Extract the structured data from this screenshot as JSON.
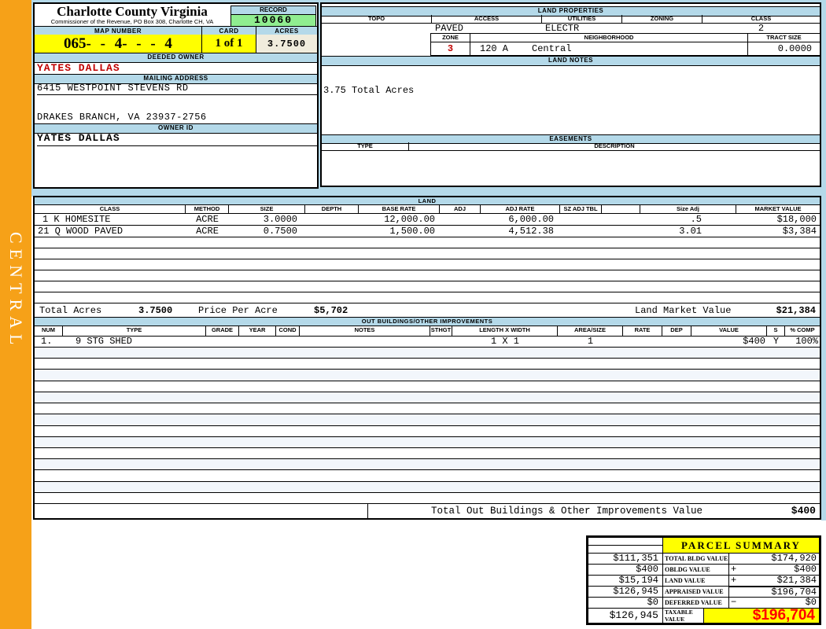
{
  "sidebar": {
    "district": "CENTRAL"
  },
  "header": {
    "county": "Charlotte County Virginia",
    "commissioner": "Commissioner of the Revenue, PO Box 308, Charlotte CH, VA",
    "record_label": "RECORD",
    "record_value": "10060",
    "map_number_label": "MAP NUMBER",
    "map_number": "065- - 4- - - 4",
    "card_label": "CARD",
    "card_value": "1 of 1",
    "acres_label": "ACRES",
    "acres_value": "3.7500"
  },
  "owner": {
    "deeded_owner_label": "DEEDED OWNER",
    "deeded_owner": "YATES DALLAS",
    "mailing_address_label": "MAILING ADDRESS",
    "address_line1": "6415 WESTPOINT STEVENS RD",
    "address_line2": "DRAKES BRANCH, VA 23937-2756",
    "owner_id_label": "OWNER ID",
    "owner_id": "YATES DALLAS"
  },
  "land_properties": {
    "title": "LAND PROPERTIES",
    "headers": [
      "TOPO",
      "ACCESS",
      "UTILITIES",
      "ZONING",
      "CLASS"
    ],
    "topo": "",
    "access": "PAVED",
    "utilities": "ELECTR",
    "zoning": "",
    "class_value": "2",
    "zone_label": "ZONE",
    "zone_value": "3",
    "neighborhood_label": "NEIGHBORHOOD",
    "neighborhood_code": "120 A",
    "neighborhood_name": "Central",
    "tract_size_label": "TRACT SIZE",
    "tract_size": "0.0000"
  },
  "land_notes": {
    "title": "LAND NOTES",
    "note": "3.75 Total Acres"
  },
  "easements": {
    "title": "EASEMENTS",
    "type_label": "TYPE",
    "description_label": "DESCRIPTION"
  },
  "land": {
    "title": "LAND",
    "headers": [
      "CLASS",
      "METHOD",
      "SIZE",
      "DEPTH",
      "BASE RATE",
      "ADJ",
      "ADJ RATE",
      "SZ ADJ TBL",
      "",
      "Size Adj",
      "MARKET VALUE"
    ],
    "rows": [
      [
        "1 K HOMESITE",
        "ACRE",
        "3.0000",
        "",
        "12,000.00",
        "",
        "6,000.00",
        "",
        "",
        ".5",
        "$18,000"
      ],
      [
        "21 Q WOOD PAVED",
        "ACRE",
        "0.7500",
        "",
        "1,500.00",
        "",
        "4,512.38",
        "",
        "",
        "3.01",
        "$3,384"
      ]
    ],
    "empty_rows": 6,
    "totals": {
      "total_acres_label": "Total Acres",
      "total_acres": "3.7500",
      "price_per_acre_label": "Price Per Acre",
      "price_per_acre": "$5,702",
      "land_market_value_label": "Land Market Value",
      "land_market_value": "$21,384"
    }
  },
  "out_buildings": {
    "title": "OUT BUILDINGS/OTHER IMPROVEMENTS",
    "headers": [
      "NUM",
      "TYPE",
      "GRADE",
      "YEAR",
      "COND",
      "NOTES",
      "STHGT",
      "LENGTH X WIDTH",
      "AREA/SIZE",
      "RATE",
      "DEP",
      "VALUE",
      "S",
      "% COMP"
    ],
    "rows": [
      [
        "1.",
        "9 STG SHED",
        "",
        "",
        "",
        "",
        "",
        "1 X 1",
        "1",
        "",
        "",
        "$400",
        "Y",
        "100%"
      ]
    ],
    "empty_rows": 14,
    "total_label": "Total Out Buildings & Other Improvements Value",
    "total_value": "$400"
  },
  "parcel_summary": {
    "title": "PARCEL SUMMARY",
    "rows": [
      [
        "$111,351",
        "TOTAL BLDG VALUE",
        "",
        "$174,920"
      ],
      [
        "$400",
        "OBLDG VALUE",
        "+",
        "$400"
      ],
      [
        "$15,194",
        "LAND VALUE",
        "+",
        "$21,384"
      ],
      [
        "$126,945",
        "APPRAISED VALUE",
        "",
        "$196,704"
      ],
      [
        "$0",
        "DEFERRED VALUE",
        "−",
        "$0"
      ]
    ],
    "taxable": {
      "prior": "$126,945",
      "label": "TAXABLE VALUE",
      "value": "$196,704"
    }
  },
  "colors": {
    "band_blue": "#b4d9e9",
    "record_green": "#90ee90",
    "highlight_yellow": "#ffff00",
    "acres_beige": "#f0ecdd",
    "sidebar_orange": "#f6a118",
    "owner_red": "#c00000",
    "taxable_red": "#ff0000"
  }
}
